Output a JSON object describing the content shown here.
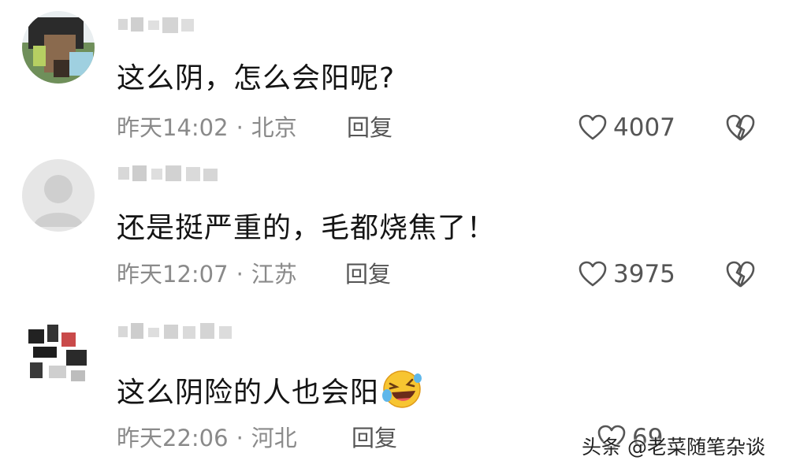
{
  "comments": [
    {
      "username": "",
      "text": "这么阴，怎么会阳呢?",
      "time": "昨天14:02",
      "location": "北京",
      "reply_label": "回复",
      "likes": "4007"
    },
    {
      "username": "",
      "text": "还是挺严重的，毛都烧焦了！",
      "time": "昨天12:07",
      "location": "江苏",
      "reply_label": "回复",
      "likes": "3975"
    },
    {
      "username": "",
      "text": "这么阴险的人也会阳",
      "emoji": "laughing-tears-emoji",
      "time": "昨天22:06",
      "location": "河北",
      "reply_label": "回复",
      "likes": "69"
    }
  ],
  "watermark": "头条 @老菜随笔杂谈",
  "icons": {
    "like": "heart-outline-icon",
    "dislike": "broken-heart-icon"
  },
  "colors": {
    "text": "#141414",
    "meta": "#8a8a8a",
    "icon": "#555555"
  }
}
